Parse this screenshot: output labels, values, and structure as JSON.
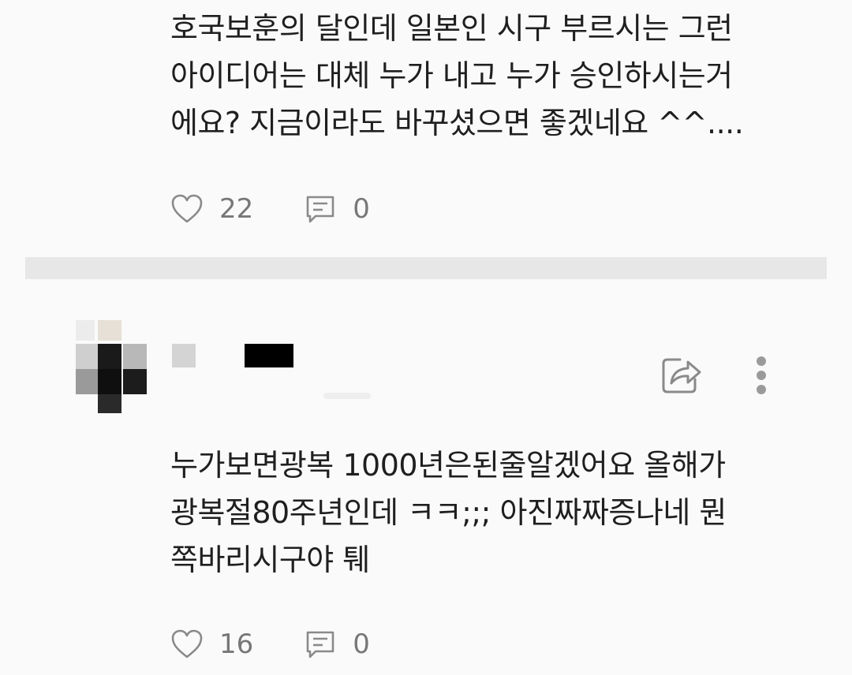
{
  "comments": [
    {
      "lines": [
        "호국보훈의 달인데 일본인 시구 부르시는 그런",
        "아이디어는 대체 누가 내고 누가 승인하시는거",
        "에요? 지금이라도 바꾸셨으면 좋겠네요 ^^...."
      ],
      "likes": "22",
      "replies": "0"
    },
    {
      "lines": [
        "누가보면광복 1000년은된줄알겠어요 올해가",
        "광복절80주년인데 ㅋㅋ;;; 아진짜짜증나네 뭔",
        "쪽바리시구야 퉤"
      ],
      "likes": "16",
      "replies": "0"
    }
  ],
  "icons": {
    "like": "heart-outline-icon",
    "reply": "speech-bubble-icon",
    "share": "share-arrow-icon",
    "more": "vertical-dots-icon"
  },
  "colors": {
    "background": "#fafafa",
    "divider": "#e7e7e7",
    "icon": "#8a8a8a",
    "text": "#1f1f1f",
    "count": "#777777"
  }
}
